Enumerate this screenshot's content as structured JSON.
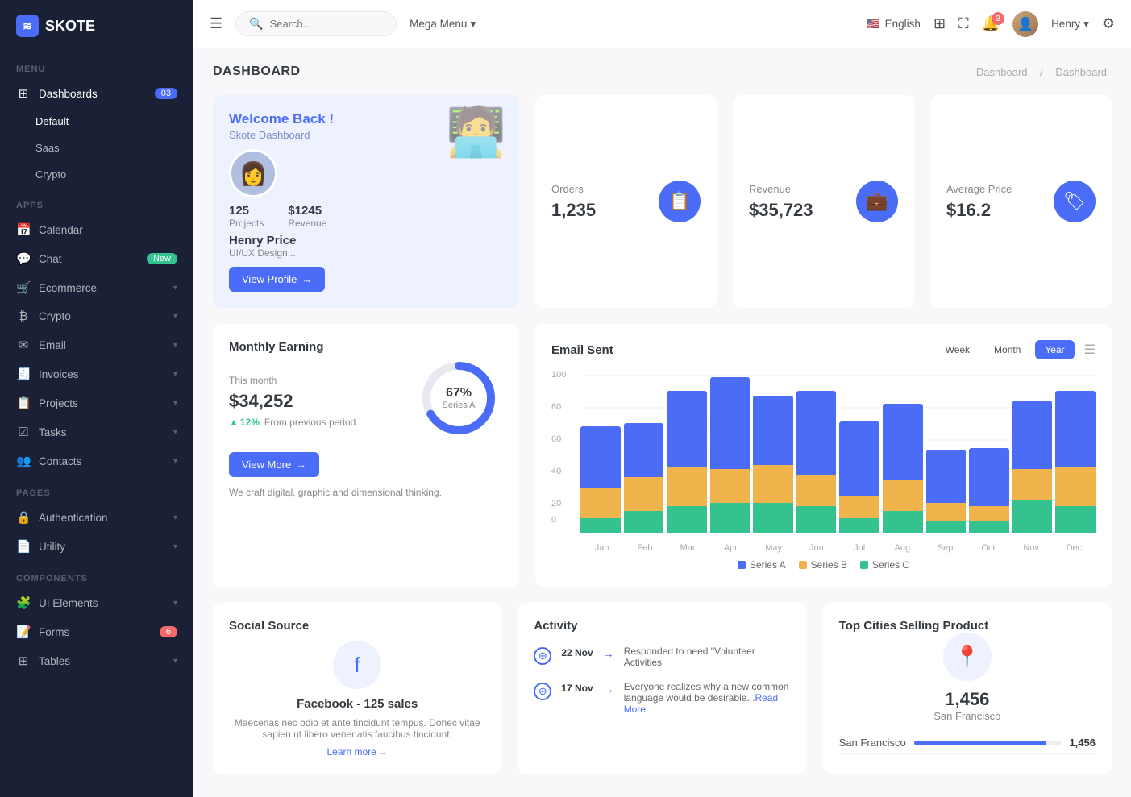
{
  "app": {
    "name": "SKOTE",
    "logo_icon": "≋"
  },
  "sidebar": {
    "menu_label": "MENU",
    "apps_label": "APPS",
    "pages_label": "PAGES",
    "components_label": "COMPONENTS",
    "items": {
      "dashboards": "Dashboards",
      "dashboards_badge": "03",
      "default": "Default",
      "saas": "Saas",
      "crypto": "Crypto",
      "calendar": "Calendar",
      "chat": "Chat",
      "chat_badge": "New",
      "ecommerce": "Ecommerce",
      "crypto_apps": "Crypto",
      "email": "Email",
      "invoices": "Invoices",
      "projects": "Projects",
      "tasks": "Tasks",
      "contacts": "Contacts",
      "authentication": "Authentication",
      "utility": "Utility",
      "ui_elements": "UI Elements",
      "forms": "Forms",
      "forms_badge": "6",
      "tables": "Tables"
    }
  },
  "topbar": {
    "search_placeholder": "Search...",
    "mega_menu": "Mega Menu",
    "language": "English",
    "user_name": "Henry",
    "notification_count": "3"
  },
  "page": {
    "title": "DASHBOARD",
    "breadcrumb1": "Dashboard",
    "breadcrumb_sep": "/",
    "breadcrumb2": "Dashboard"
  },
  "welcome_card": {
    "title": "Welcome Back !",
    "subtitle": "Skote Dashboard",
    "projects_count": "125",
    "projects_label": "Projects",
    "revenue_value": "$1245",
    "revenue_label": "Revenue",
    "user_name": "Henry Price",
    "user_role": "UI/UX Design...",
    "view_profile_btn": "View Profile"
  },
  "stats": {
    "orders_label": "Orders",
    "orders_value": "1,235",
    "revenue_label": "Revenue",
    "revenue_value": "$35,723",
    "avg_price_label": "Average Price",
    "avg_price_value": "$16.2"
  },
  "email_chart": {
    "title": "Email Sent",
    "tab_week": "Week",
    "tab_month": "Month",
    "tab_year": "Year",
    "y_labels": [
      "100",
      "80",
      "60",
      "40",
      "20",
      "0"
    ],
    "x_labels": [
      "Jan",
      "Feb",
      "Mar",
      "Apr",
      "May",
      "Jun",
      "Jul",
      "Aug",
      "Sep",
      "Oct",
      "Nov",
      "Dec"
    ],
    "legend_a": "Series A",
    "legend_b": "Series B",
    "legend_c": "Series C",
    "color_a": "#4a6cf7",
    "color_b": "#f1b44c",
    "color_c": "#34c38f",
    "bars": [
      {
        "a": 40,
        "b": 20,
        "c": 10
      },
      {
        "a": 35,
        "b": 22,
        "c": 15
      },
      {
        "a": 50,
        "b": 25,
        "c": 18
      },
      {
        "a": 60,
        "b": 22,
        "c": 20
      },
      {
        "a": 45,
        "b": 25,
        "c": 20
      },
      {
        "a": 55,
        "b": 20,
        "c": 18
      },
      {
        "a": 48,
        "b": 15,
        "c": 10
      },
      {
        "a": 50,
        "b": 20,
        "c": 15
      },
      {
        "a": 35,
        "b": 12,
        "c": 8
      },
      {
        "a": 38,
        "b": 10,
        "c": 8
      },
      {
        "a": 45,
        "b": 20,
        "c": 22
      },
      {
        "a": 50,
        "b": 25,
        "c": 18
      }
    ]
  },
  "monthly": {
    "title": "Monthly Earning",
    "period_label": "This month",
    "amount": "$34,252",
    "change_pct": "12%",
    "change_label": "From previous period",
    "donut_pct": "67%",
    "donut_series": "Series A",
    "view_more_btn": "View More",
    "desc": "We craft digital, graphic and dimensional thinking."
  },
  "social": {
    "title": "Social Source",
    "platform": "Facebook",
    "sales": "125 sales",
    "description": "Maecenas nec odio et ante tincidunt tempus. Donec vitae sapien ut libero venenatis faucibus tincidunt.",
    "learn_more": "Learn more"
  },
  "activity": {
    "title": "Activity",
    "items": [
      {
        "date": "22 Nov",
        "text": "Responded to need \"Volunteer Activities",
        "link": ""
      },
      {
        "date": "17 Nov",
        "text": "Everyone realizes why a new common language would be desirable...",
        "link": "Read More"
      }
    ]
  },
  "cities": {
    "title": "Top Cities Selling Product",
    "count": "1,456",
    "city_name": "San Francisco",
    "rows": [
      {
        "city": "San Francisco",
        "value": "1,456",
        "pct": 90
      }
    ]
  }
}
